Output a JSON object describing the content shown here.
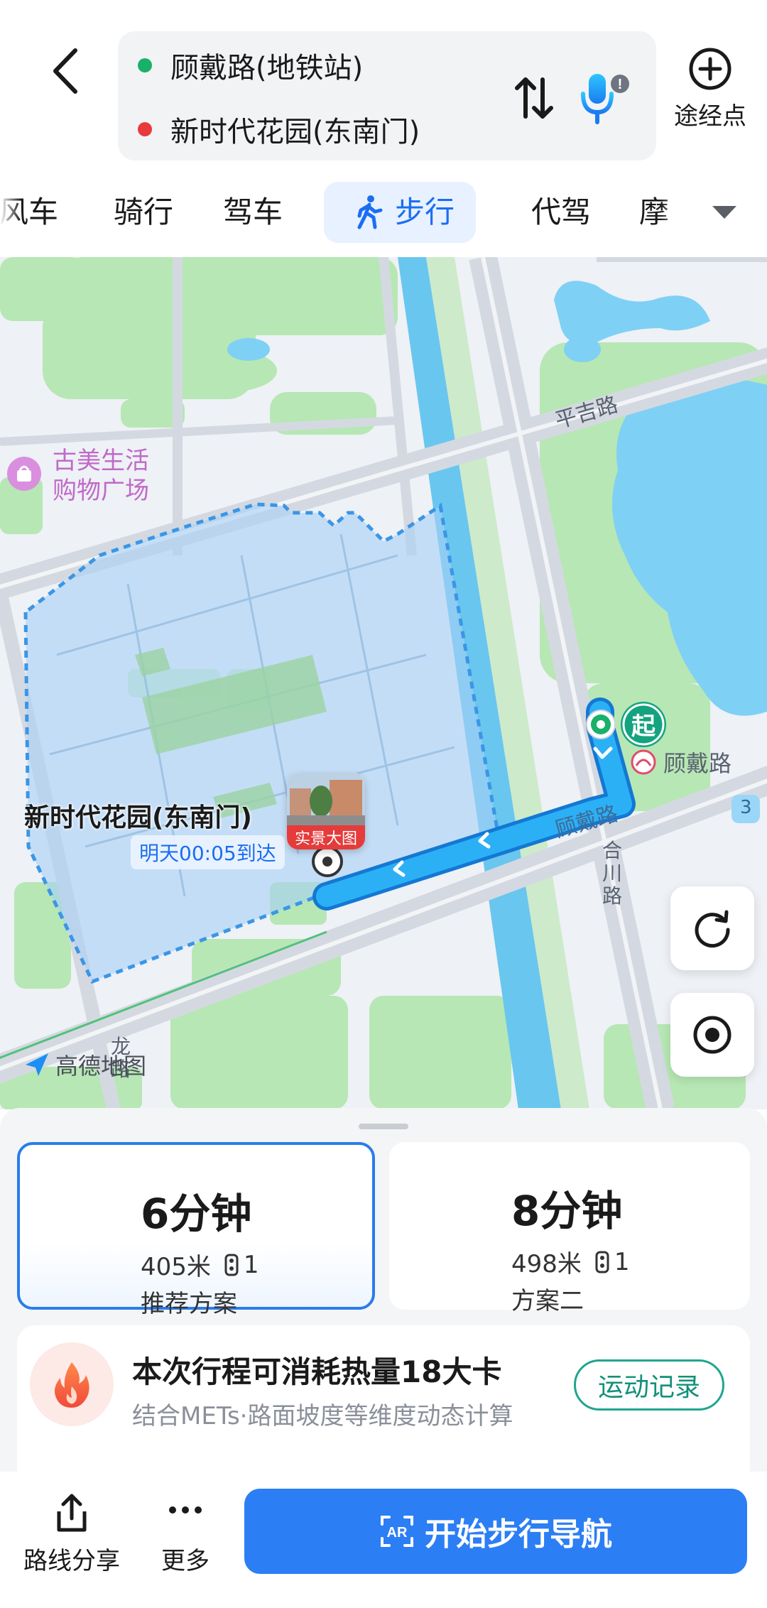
{
  "header": {
    "start_point": "顾戴路(地铁站)",
    "end_point": "新时代花园(东南门)",
    "waypoint_label": "途经点"
  },
  "tabs": {
    "items": [
      "风车",
      "骑行",
      "驾车",
      "步行",
      "代驾",
      "摩"
    ],
    "active": "步行"
  },
  "map": {
    "poi_mall_line1": "古美生活",
    "poi_mall_line2": "购物广场",
    "road_pingji": "平吉路",
    "road_gudai_station": "顾戴路",
    "road_gudai_route": "顾戴路",
    "road_hechuan": "合川路",
    "road_long": "龙路",
    "start_marker": "起",
    "destination_name": "新时代花园(东南门)",
    "arrival_time": "明天00:05到达",
    "street_view_label": "实景大图",
    "route_badge": "3",
    "logo_text": "高德地图"
  },
  "plans": [
    {
      "time": "6分钟",
      "distance": "405米",
      "lights": "1",
      "desc": "推荐方案",
      "selected": true
    },
    {
      "time": "8分钟",
      "distance": "498米",
      "lights": "1",
      "desc": "方案二",
      "selected": false
    }
  ],
  "calorie": {
    "title": "本次行程可消耗热量18大卡",
    "subtitle": "结合METs·路面坡度等维度动态计算",
    "button": "运动记录"
  },
  "footer": {
    "share_label": "路线分享",
    "more_label": "更多",
    "navigate_label": "开始步行导航"
  },
  "colors": {
    "accent_blue": "#2c7ef4",
    "route_blue": "#1e9df0",
    "start_green": "#19b06a",
    "end_red": "#e83a3a",
    "teal": "#12907a"
  }
}
